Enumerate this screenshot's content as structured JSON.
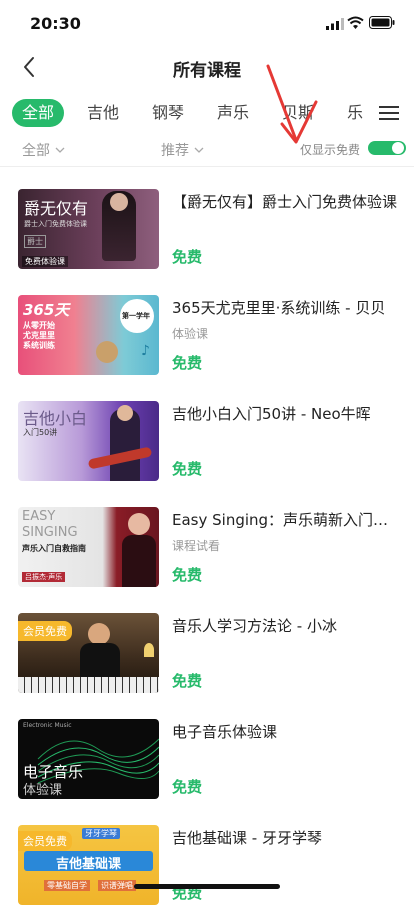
{
  "status": {
    "time": "20:30"
  },
  "nav": {
    "title": "所有课程"
  },
  "tabs": [
    {
      "label": "全部",
      "active": true
    },
    {
      "label": "吉他"
    },
    {
      "label": "钢琴"
    },
    {
      "label": "声乐"
    },
    {
      "label": "贝斯"
    },
    {
      "label": "乐"
    }
  ],
  "filters": {
    "scope": "全部",
    "sort": "推荐",
    "free_only_label": "仅显示免费",
    "free_only_on": true
  },
  "colors": {
    "accent": "#27ba6b",
    "annotation": "#e53935"
  },
  "courses": [
    {
      "title": "【爵无仅有】爵士入门免费体验课",
      "subtitle": "",
      "price": "免费",
      "thumb": {
        "main": "爵无仅有",
        "sub": "爵士入门免费体验课",
        "tag": "免费体验课",
        "corner": "爵士"
      }
    },
    {
      "title": "365天尤克里里·系统训练 - 贝贝",
      "subtitle": "体验课",
      "price": "免费",
      "thumb": {
        "main": "365天",
        "sub": "从零开始\n尤克里里\n系统训练",
        "badge": "第一学年"
      }
    },
    {
      "title": "吉他小白入门50讲 - Neo牛晖",
      "subtitle": "",
      "price": "免费",
      "thumb": {
        "main": "吉他小白",
        "sub": "入门50讲"
      }
    },
    {
      "title": "Easy Singing：声乐萌新入门指南",
      "subtitle": "课程试看",
      "price": "免费",
      "thumb": {
        "main": "EASY SINGING",
        "sub": "声乐入门自救指南",
        "tag": "吕振杰·声乐"
      }
    },
    {
      "title": "音乐人学习方法论 - 小冰",
      "subtitle": "",
      "price": "免费",
      "thumb": {
        "tag": "会员免费"
      }
    },
    {
      "title": "电子音乐体验课",
      "subtitle": "",
      "price": "免费",
      "thumb": {
        "main": "电子音乐",
        "sub": "体验课",
        "corner": "Electronic Music"
      }
    },
    {
      "title": "吉他基础课 - 牙牙学琴",
      "subtitle": "",
      "price": "免费",
      "thumb": {
        "tag": "会员免费",
        "main": "吉他基础课",
        "sub": "零基础自学",
        "sub2": "识谱弹唱",
        "corner": "牙牙学琴"
      }
    }
  ]
}
